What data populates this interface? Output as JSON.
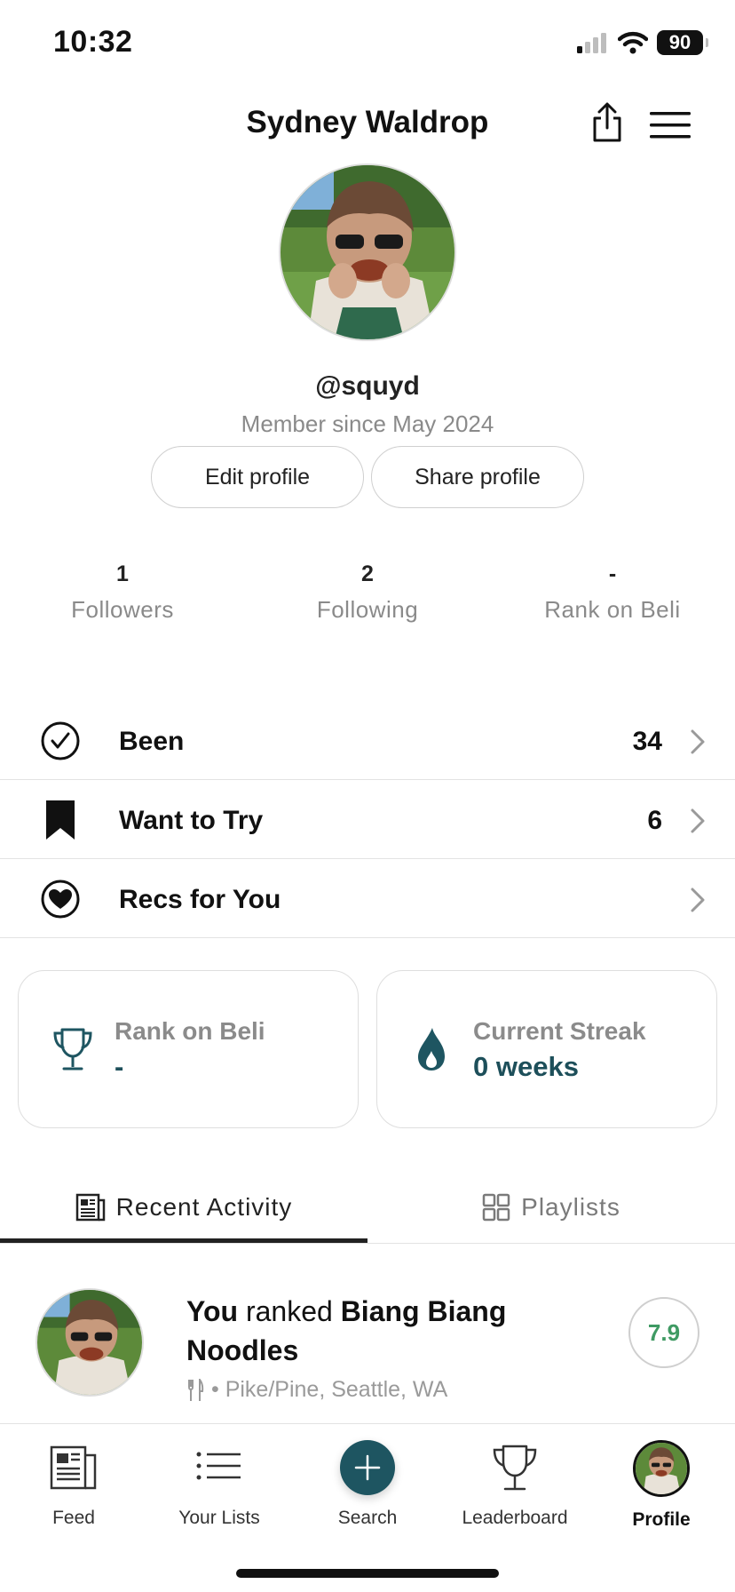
{
  "status_bar": {
    "time": "10:32",
    "battery": "90"
  },
  "header": {
    "title": "Sydney Waldrop"
  },
  "profile": {
    "username": "@squyd",
    "member_since": "Member since May 2024",
    "edit_label": "Edit profile",
    "share_label": "Share profile"
  },
  "stats": [
    {
      "value": "1",
      "label": "Followers"
    },
    {
      "value": "2",
      "label": "Following"
    },
    {
      "value": "-",
      "label": "Rank on Beli"
    }
  ],
  "lists": [
    {
      "label": "Been",
      "count": "34",
      "icon": "check-circle-icon"
    },
    {
      "label": "Want to Try",
      "count": "6",
      "icon": "bookmark-icon"
    },
    {
      "label": "Recs for You",
      "count": "",
      "icon": "heart-circle-icon"
    }
  ],
  "cards": {
    "rank": {
      "label": "Rank on Beli",
      "value": "-",
      "icon": "trophy-icon"
    },
    "streak": {
      "label": "Current Streak",
      "value": "0 weeks",
      "icon": "flame-icon"
    }
  },
  "tabs": {
    "recent": "Recent Activity",
    "playlists": "Playlists"
  },
  "activity": {
    "you": "You",
    "action": "ranked",
    "place": "Biang Biang Noodles",
    "meta": "• Pike/Pine, Seattle, WA",
    "score": "7.9"
  },
  "nav": {
    "feed": "Feed",
    "lists": "Your Lists",
    "search": "Search",
    "leaderboard": "Leaderboard",
    "profile": "Profile"
  },
  "colors": {
    "accent_teal": "#1e5561",
    "score_green": "#3f9a63",
    "muted_text": "#8a8a8a"
  }
}
